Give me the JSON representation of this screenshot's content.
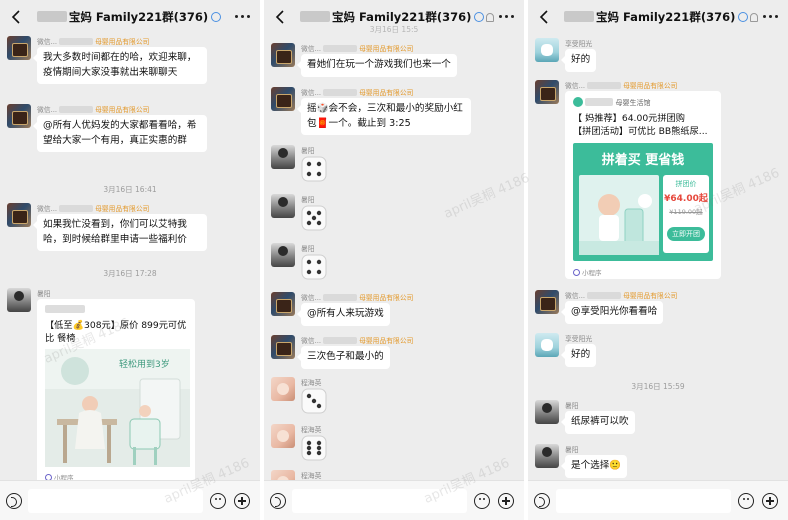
{
  "panels": [
    {
      "title": "宝妈 Family221群(376)",
      "messages": [
        {
          "org": "母婴用品有限公司",
          "text": "我大多数时间都在的哈，欢迎来聊，疫情期间大家没事就出来聊聊天"
        },
        {
          "org": "母婴用品有限公司",
          "text": "@所有人优妈发的大家都看看哈，希望给大家一个有用，真正实惠的群"
        },
        {
          "org": "母婴用品有限公司",
          "text": "如果我忙没看到，你们可以艾特我哈，到时候给群里申请一些福利价"
        }
      ],
      "timestamps": [
        "3月16日 16:41",
        "3月16日 17:28"
      ],
      "sender_name_1": "微信...",
      "last_sender": "暑阳",
      "card": {
        "title": "【低至💰308元】原价 899元可优比    餐椅",
        "banner": "轻松用到3岁",
        "footer": "小程序"
      }
    },
    {
      "title": "宝妈 Family221群(376)",
      "top_stamp": "3月16日 15:5",
      "messages": [
        {
          "sender": "微信...",
          "org": "母婴用品有限公司",
          "text": "看她们在玩一个游戏我们也来一个"
        },
        {
          "sender": "微信...",
          "org": "母婴用品有限公司",
          "text": "摇🎲会不会，三次和最小的奖励小红包🧧一个。截止到 3:25"
        },
        {
          "sender": "暑阳"
        },
        {
          "sender": "暑阳"
        },
        {
          "sender": "暑阳"
        },
        {
          "sender": "微信...",
          "org": "母婴用品有限公司",
          "text": "@所有人来玩游戏"
        },
        {
          "sender": "微信...",
          "org": "母婴用品有限公司",
          "text": "三次色子和最小的"
        },
        {
          "sender": "程海英"
        },
        {
          "sender": "程海英"
        },
        {
          "sender": "程海英"
        }
      ]
    },
    {
      "title": "宝妈 Family221群(376)",
      "messages": [
        {
          "sender": "享受阳光",
          "text": "好的"
        },
        {
          "sender": "微信...",
          "org": "母婴用品有限公司"
        },
        {
          "sender": "微信...",
          "org": "母婴用品有限公司",
          "text": "@享受阳光你看看哈"
        },
        {
          "sender": "享受阳光",
          "text": "好的"
        },
        {
          "sender": "暑阳",
          "text": "纸尿裤可以吹"
        },
        {
          "sender": "暑阳",
          "text": "是个选择🙂"
        }
      ],
      "timestamp": "3月16日 15:59",
      "card": {
        "head": "母婴生活馆",
        "line1": "【   妈推荐】64.00元拼团购",
        "line2": "【拼团活动】可优比 BB熊纸尿...",
        "banner_title": "拼着买  更省钱",
        "price_label": "拼团价",
        "price": "¥64.00起",
        "orig_price": "¥119.00起",
        "button": "立即开团",
        "footer": "小程序"
      }
    }
  ],
  "watermark": "april吴桐 4186",
  "icons": [
    "back-icon",
    "more-icon",
    "voice-icon",
    "emoji-icon",
    "plus-icon",
    "dice-icon",
    "mini-program-icon"
  ],
  "colors": {
    "chat_bg": "#ededed",
    "bubble": "#ffffff",
    "org": "#e39a2e",
    "mini_green": "#3cbc9a",
    "price_red": "#e6483c"
  }
}
